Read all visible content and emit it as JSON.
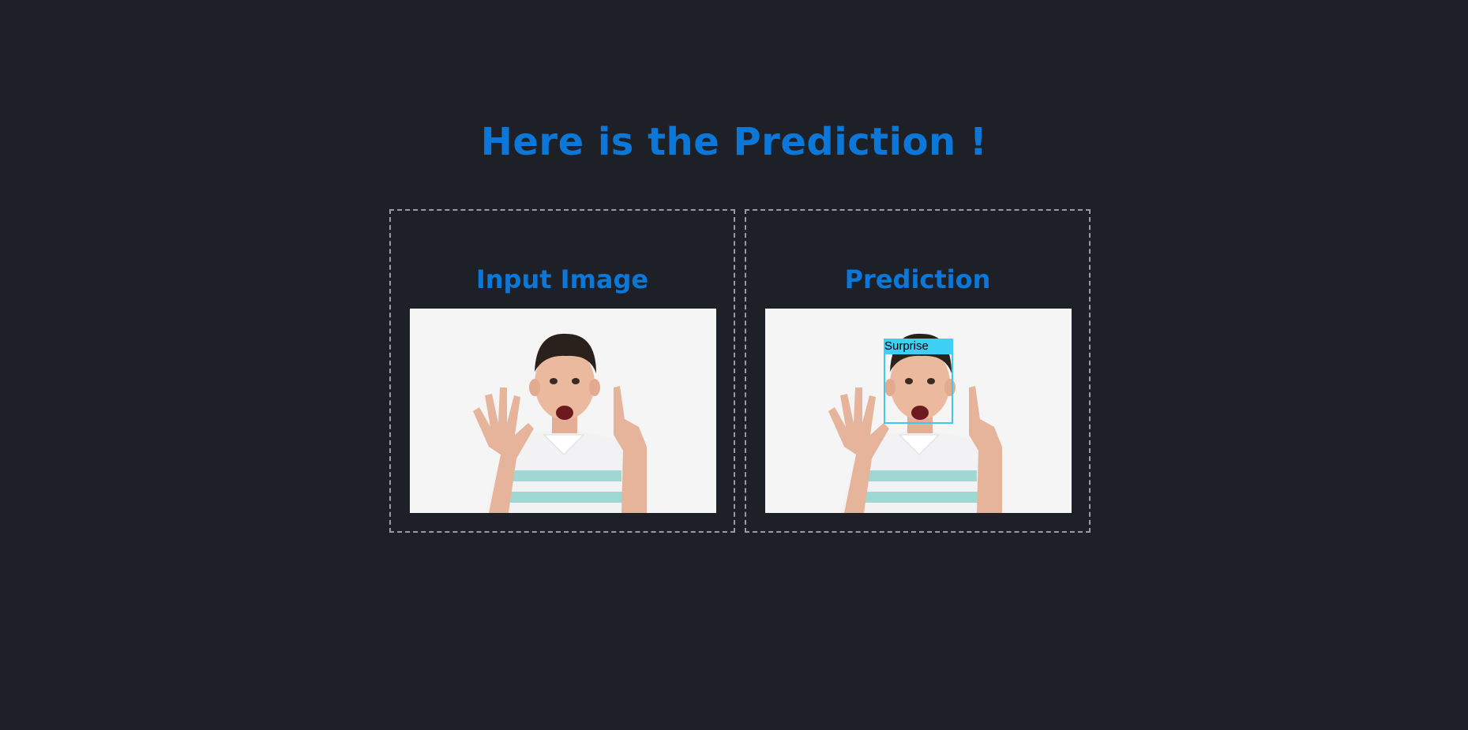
{
  "page": {
    "title": "Here is the Prediction !"
  },
  "panels": {
    "input": {
      "title": "Input Image"
    },
    "prediction": {
      "title": "Prediction",
      "detection_label": "Surprise"
    }
  },
  "colors": {
    "background": "#1e2027",
    "accent": "#0b78d9",
    "border": "#9a9ca0",
    "detection_box": "#40c8ef"
  }
}
